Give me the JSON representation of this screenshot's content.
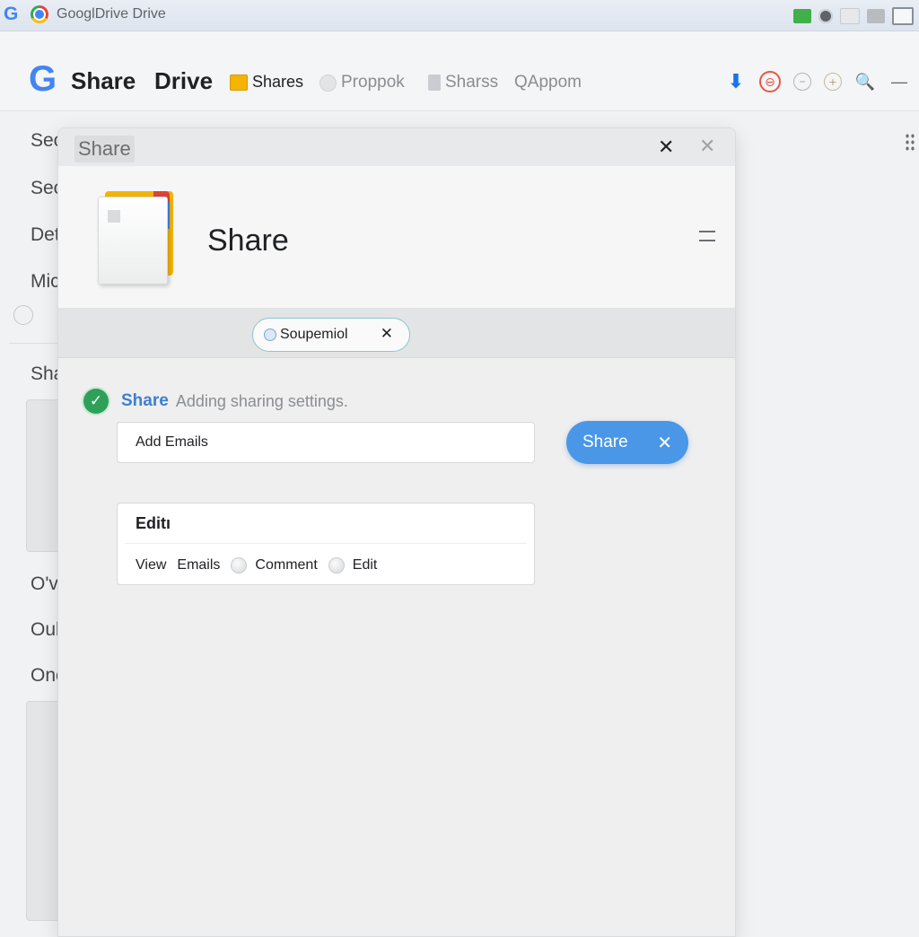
{
  "browser": {
    "logo_g": "G",
    "title": "GooglDrive Drive"
  },
  "header": {
    "brand_g": "G",
    "brand_share": "Share",
    "brand_drive": "Drive",
    "tabs": [
      {
        "label": "Shares",
        "icon": "folder-icon",
        "active": true
      },
      {
        "label": "Proppok",
        "icon": "circle-icon",
        "active": false
      },
      {
        "label": "Sharss",
        "icon": "doc-icon",
        "active": false
      },
      {
        "label": "QAppom",
        "icon": "search-icon",
        "active": false
      }
    ],
    "icons": {
      "download": "⬇",
      "red": "⊖",
      "minus": "−",
      "plus": "+",
      "search": "🔍",
      "dash": "—"
    }
  },
  "sidebar": {
    "items": [
      "Sec",
      "Sec",
      "Det",
      "Mic",
      "Sha",
      "O'vs",
      "Oul",
      "Onc"
    ]
  },
  "dialog": {
    "header_title": "Share",
    "close_glyph": "✕",
    "close2_glyph": "✕",
    "hero_title": "Share",
    "chip": {
      "label": "Soupemiol",
      "close_glyph": "✕"
    },
    "notice": {
      "check_glyph": "✓",
      "strong": "Share",
      "text": "Adding sharing settings."
    },
    "email_input": {
      "value": "",
      "placeholder": "Add Emails"
    },
    "share_button": {
      "label": "Share",
      "close_glyph": "✕"
    },
    "permissions": {
      "title": "Editı",
      "options": [
        "View",
        "Emails",
        "Comment",
        "Edit"
      ]
    }
  },
  "colors": {
    "accent": "#4a97e8",
    "brand_blue": "#4285f4",
    "success": "#2ea05a",
    "folder": "#f4b400"
  }
}
